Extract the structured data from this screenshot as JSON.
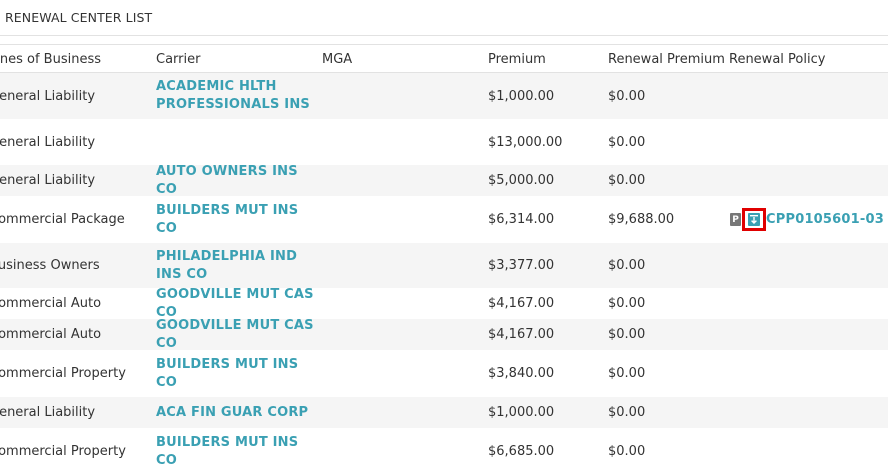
{
  "panel": {
    "title": "RENEWAL CENTER LIST"
  },
  "columns": {
    "line_of_business": "Lines of Business",
    "carrier": "Carrier",
    "mga": "MGA",
    "premium": "Premium",
    "renewal_premium": "Renewal Premium",
    "renewal_policy": "Renewal Policy"
  },
  "rows": [
    {
      "line": "General Liability",
      "carrier": "ACADEMIC HLTH PROFESSIONALS INS",
      "mga": "",
      "premium": "$1,000.00",
      "renewal_premium": "$0.00",
      "renewal_policy": ""
    },
    {
      "line": "General Liability",
      "carrier": "",
      "mga": "",
      "premium": "$13,000.00",
      "renewal_premium": "$0.00",
      "renewal_policy": ""
    },
    {
      "line": "General Liability",
      "carrier": "AUTO OWNERS INS CO",
      "mga": "",
      "premium": "$5,000.00",
      "renewal_premium": "$0.00",
      "renewal_policy": ""
    },
    {
      "line": "Commercial Package",
      "carrier": "BUILDERS MUT INS CO",
      "mga": "",
      "premium": "$6,314.00",
      "renewal_premium": "$9,688.00",
      "renewal_policy": "CPP0105601-03",
      "badge": "P"
    },
    {
      "line": "Business Owners",
      "carrier": "PHILADELPHIA IND INS CO",
      "mga": "",
      "premium": "$3,377.00",
      "renewal_premium": "$0.00",
      "renewal_policy": ""
    },
    {
      "line": "Commercial Auto",
      "carrier": "GOODVILLE MUT CAS CO",
      "mga": "",
      "premium": "$4,167.00",
      "renewal_premium": "$0.00",
      "renewal_policy": ""
    },
    {
      "line": "Commercial Auto",
      "carrier": "GOODVILLE MUT CAS CO",
      "mga": "",
      "premium": "$4,167.00",
      "renewal_premium": "$0.00",
      "renewal_policy": ""
    },
    {
      "line": "Commercial Property",
      "carrier": "BUILDERS MUT INS CO",
      "mga": "",
      "premium": "$3,840.00",
      "renewal_premium": "$0.00",
      "renewal_policy": ""
    },
    {
      "line": "General Liability",
      "carrier": "ACA FIN GUAR CORP",
      "mga": "",
      "premium": "$1,000.00",
      "renewal_premium": "$0.00",
      "renewal_policy": ""
    },
    {
      "line": "Commercial Property",
      "carrier": "BUILDERS MUT INS CO",
      "mga": "",
      "premium": "$6,685.00",
      "renewal_premium": "$0.00",
      "renewal_policy": ""
    }
  ],
  "icons": {
    "document": "document-icon"
  },
  "colors": {
    "link": "#3aa0b3",
    "highlight": "#e00000",
    "alt_row": "#f5f5f5"
  }
}
